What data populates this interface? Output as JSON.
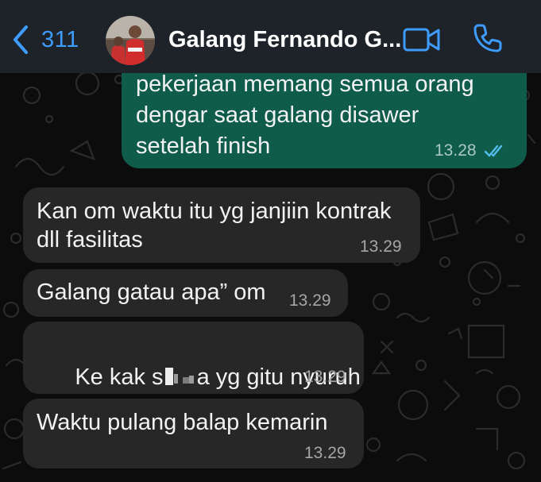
{
  "header": {
    "back_count": "311",
    "contact_name": "Galang Fernando G...",
    "icons": {
      "back": "chevron-left-icon",
      "video": "video-camera-icon",
      "call": "phone-icon"
    }
  },
  "colors": {
    "accent": "#3f9cff",
    "outgoing_bubble": "#0f5c4b",
    "incoming_bubble": "#272727",
    "read_ticks": "#53bdeb"
  },
  "messages": [
    {
      "direction": "out",
      "lines": [
        "pekerjaan memang semua orang",
        "dengar saat galang disawer",
        "setelah finish"
      ],
      "time": "13.28",
      "status": "read"
    },
    {
      "direction": "in",
      "lines": [
        "Kan om waktu itu yg janjiin kontrak",
        "dll fasilitas"
      ],
      "time": "13.29"
    },
    {
      "direction": "in",
      "lines": [
        "Galang gatau apa” om"
      ],
      "time": "13.29"
    },
    {
      "direction": "in",
      "text_before": "Ke kak s",
      "text_after": "a yg gitu nyuruh",
      "time": "13.29"
    },
    {
      "direction": "in",
      "lines": [
        "Waktu pulang balap kemarin"
      ],
      "time": "13.29"
    }
  ]
}
